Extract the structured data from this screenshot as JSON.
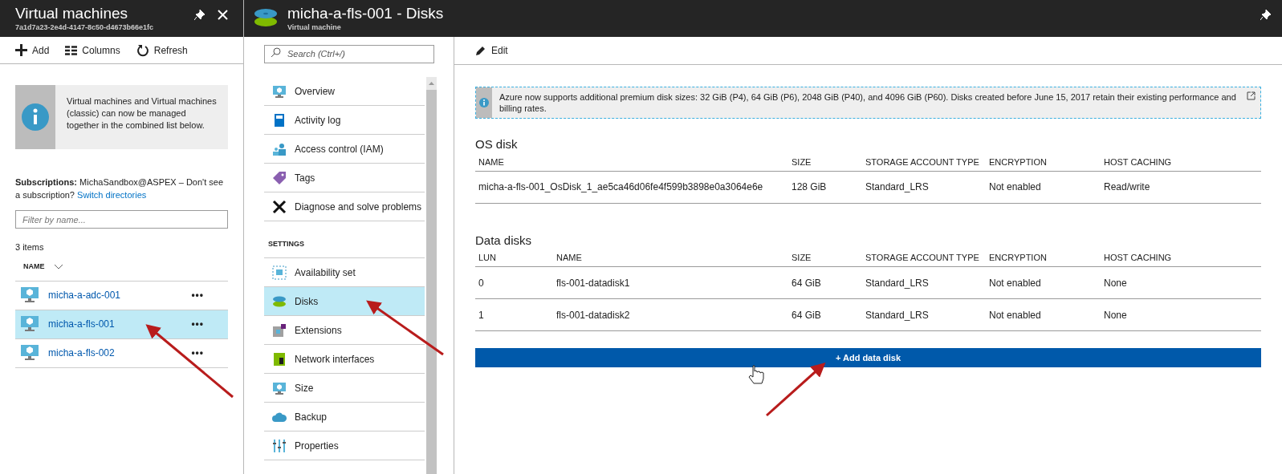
{
  "left_blade": {
    "title": "Virtual machines",
    "subtitle": "7a1d7a23-2e4d-4147-8c50-d4673b66e1fc",
    "toolbar": [
      {
        "kind": "add",
        "label": "Add"
      },
      {
        "kind": "columns",
        "label": "Columns"
      },
      {
        "kind": "refresh",
        "label": "Refresh"
      }
    ],
    "info": "Virtual machines and Virtual machines (classic) can now be managed together in the combined list below.",
    "subscriptions_label": "Subscriptions:",
    "subscriptions_text": "MichaSandbox@ASPEX – Don't see a subscription?",
    "switch_link": "Switch directories",
    "filter": {
      "placeholder": "Filter by name..."
    },
    "count": "3 items",
    "column": "NAME",
    "rows": [
      {
        "name": "micha-a-adc-001",
        "more": "•••",
        "selected": false
      },
      {
        "name": "micha-a-fls-001",
        "more": "•••",
        "selected": true
      },
      {
        "name": "micha-a-fls-002",
        "more": "•••",
        "selected": false
      }
    ]
  },
  "main_blade": {
    "title": "micha-a-fls-001 - Disks",
    "subtitle": "Virtual machine",
    "search": {
      "placeholder": "Search (Ctrl+/)"
    },
    "menu": [
      {
        "kind": "item",
        "label": "Overview",
        "selected": false
      },
      {
        "kind": "item",
        "label": "Activity log",
        "selected": false
      },
      {
        "kind": "item",
        "label": "Access control (IAM)",
        "selected": false
      },
      {
        "kind": "item",
        "label": "Tags",
        "selected": false
      },
      {
        "kind": "item",
        "label": "Diagnose and solve problems",
        "selected": false
      },
      {
        "kind": "heading",
        "label": "SETTINGS"
      },
      {
        "kind": "item",
        "label": "Availability set",
        "selected": false
      },
      {
        "kind": "item",
        "label": "Disks",
        "selected": true
      },
      {
        "kind": "item",
        "label": "Extensions",
        "selected": false
      },
      {
        "kind": "item",
        "label": "Network interfaces",
        "selected": false
      },
      {
        "kind": "item",
        "label": "Size",
        "selected": false
      },
      {
        "kind": "item",
        "label": "Backup",
        "selected": false
      },
      {
        "kind": "item",
        "label": "Properties",
        "selected": false
      }
    ],
    "edit": "Edit",
    "notice": "Azure now supports additional premium disk sizes: 32 GiB (P4), 64 GiB (P6), 2048 GiB (P40), and 4096 GiB (P60). Disks created before June 15, 2017 retain their existing performance and billing rates.",
    "os_disk": {
      "title": "OS disk",
      "columns": [
        "NAME",
        "SIZE",
        "STORAGE ACCOUNT TYPE",
        "ENCRYPTION",
        "HOST CACHING"
      ],
      "rows": [
        [
          "micha-a-fls-001_OsDisk_1_ae5ca46d06fe4f599b3898e0a3064e6e",
          "128 GiB",
          "Standard_LRS",
          "Not enabled",
          "Read/write"
        ]
      ]
    },
    "data_disks": {
      "title": "Data disks",
      "columns": [
        "LUN",
        "NAME",
        "SIZE",
        "STORAGE ACCOUNT TYPE",
        "ENCRYPTION",
        "HOST CACHING"
      ],
      "rows": [
        [
          "0",
          "fls-001-datadisk1",
          "64 GiB",
          "Standard_LRS",
          "Not enabled",
          "None"
        ],
        [
          "1",
          "fls-001-datadisk2",
          "64 GiB",
          "Standard_LRS",
          "Not enabled",
          "None"
        ]
      ]
    },
    "add_button": "+ Add data disk"
  }
}
